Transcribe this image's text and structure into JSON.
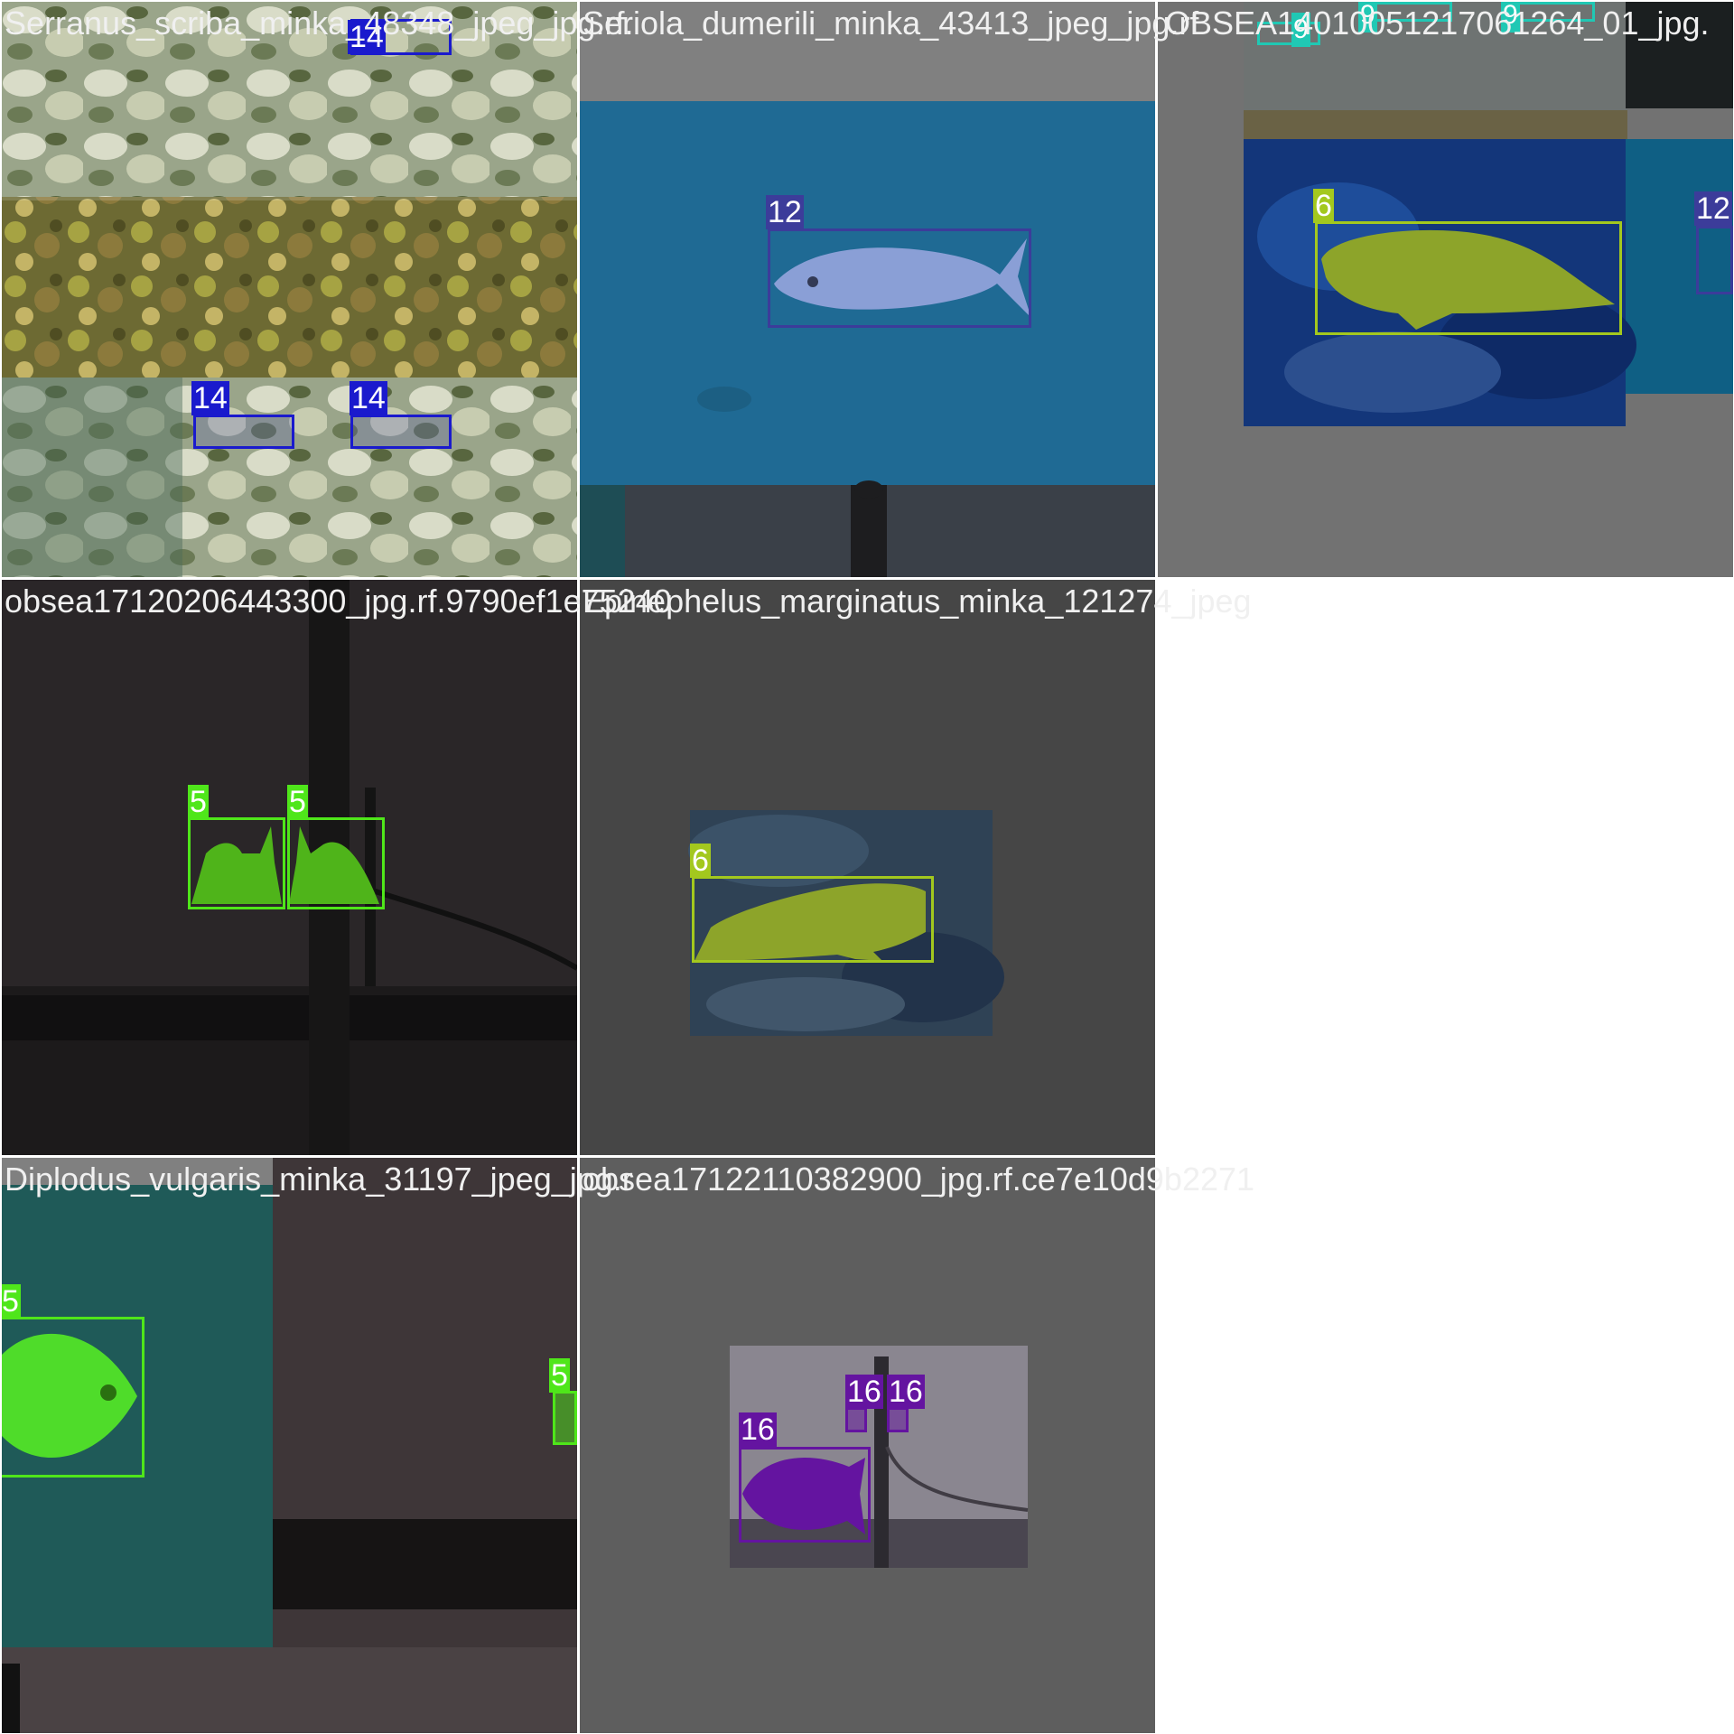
{
  "mosaic": {
    "tiles": [
      {
        "filename": "Serranus_scriba_minka_48348_jpeg_jpg.rf."
      },
      {
        "filename": "Seriola_dumerili_minka_43413_jpeg_jpg.rf"
      },
      {
        "filename": "OBSEA14010051217061264_01_jpg."
      },
      {
        "filename": "obsea17120206443300_jpg.rf.9790ef1e75240"
      },
      {
        "filename": "Epinephelus_marginatus_minka_121274_jpeg"
      },
      {
        "filename": "Diplodus_vulgaris_minka_31197_jpeg_jpg.r"
      },
      {
        "filename": "obsea17122110382900_jpg.rf.ce7e10d9b2271"
      }
    ],
    "detections": {
      "t1": [
        "14",
        "14",
        "14"
      ],
      "t2": [
        "12"
      ],
      "t3": [
        "9",
        "9",
        "9",
        "6",
        "12"
      ],
      "t4": [
        "5",
        "5"
      ],
      "t5": [
        "6"
      ],
      "t6": [
        "5",
        "5"
      ],
      "t7": [
        "16",
        "16",
        "16"
      ]
    },
    "class_colors": {
      "5": "#4fe61a",
      "6": "#a3c81e",
      "9": "#20c8b4",
      "12": "#3c3c9a",
      "14": "#1a1acd",
      "16": "#6414a0"
    }
  }
}
